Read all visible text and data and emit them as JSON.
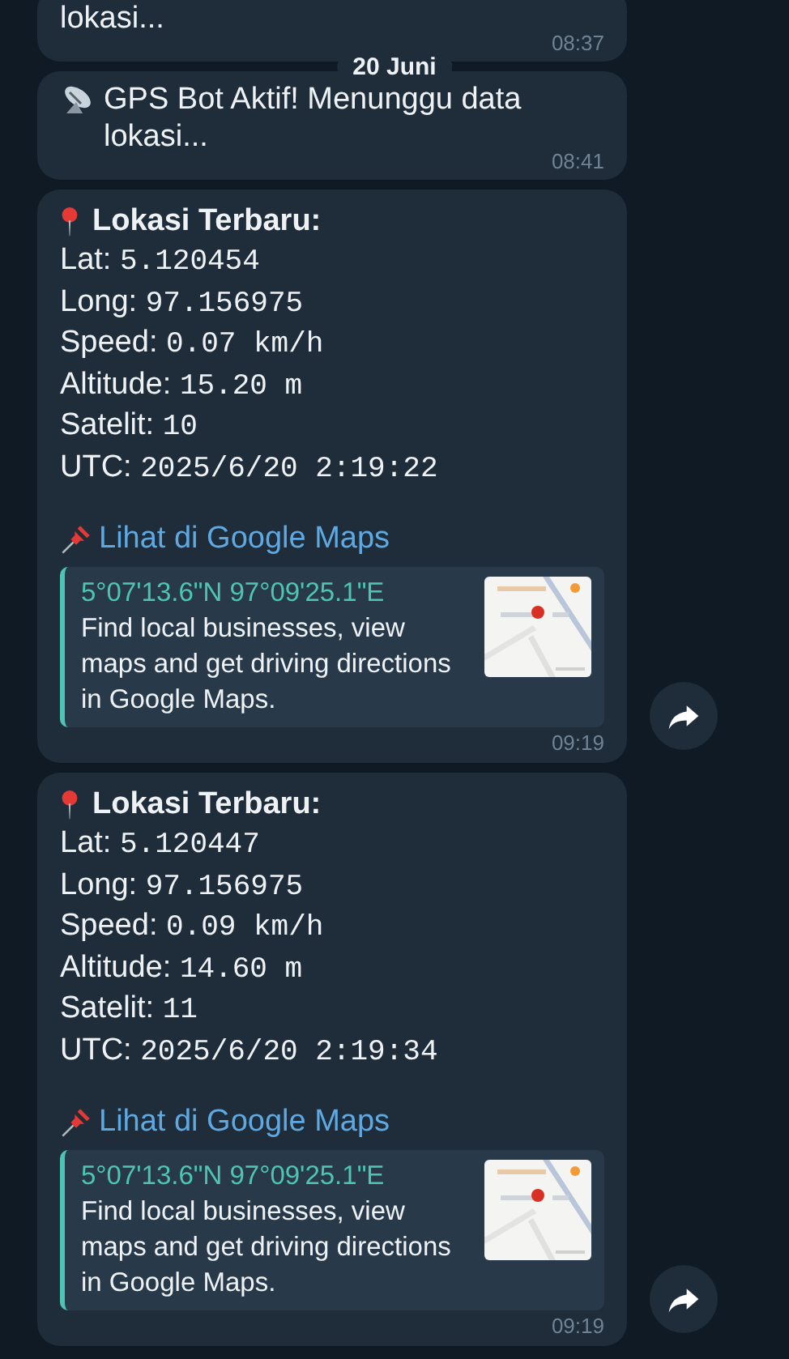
{
  "date_pill": "20 Juni",
  "messages": [
    {
      "kind": "text",
      "text": "lokasi...",
      "time": "08:37"
    },
    {
      "kind": "status",
      "text": "GPS Bot Aktif! Menunggu data lokasi...",
      "time": "08:41"
    },
    {
      "kind": "location",
      "title": "Lokasi Terbaru:",
      "fields": [
        {
          "label": "Lat:",
          "value": "5.120454"
        },
        {
          "label": "Long:",
          "value": "97.156975"
        },
        {
          "label": "Speed:",
          "value": "0.07 km/h"
        },
        {
          "label": "Altitude:",
          "value": "15.20 m"
        },
        {
          "label": "Satelit:",
          "value": "10"
        },
        {
          "label": "UTC:",
          "value": "2025/6/20 2:19:22"
        }
      ],
      "link": "Lihat di Google Maps",
      "preview": {
        "title": "5°07'13.6\"N 97°09'25.1\"E",
        "description": "Find local businesses, view maps and get driving directions in Google Maps.",
        "kind": "picture"
      },
      "time": "09:19",
      "forward": true
    },
    {
      "kind": "location",
      "title": "Lokasi Terbaru:",
      "fields": [
        {
          "label": "Lat:",
          "value": "5.120447"
        },
        {
          "label": "Long:",
          "value": "97.156975"
        },
        {
          "label": "Speed:",
          "value": "0.09 km/h"
        },
        {
          "label": "Altitude:",
          "value": "14.60 m"
        },
        {
          "label": "Satelit:",
          "value": "11"
        },
        {
          "label": "UTC:",
          "value": "2025/6/20 2:19:34"
        }
      ],
      "link": "Lihat di Google Maps",
      "preview": {
        "title": "5°07'13.6\"N 97°09'25.1\"E",
        "description": "Find local businesses, view maps and get driving directions in Google Maps.",
        "kind": "picture"
      },
      "time": "09:19",
      "forward": true
    }
  ]
}
